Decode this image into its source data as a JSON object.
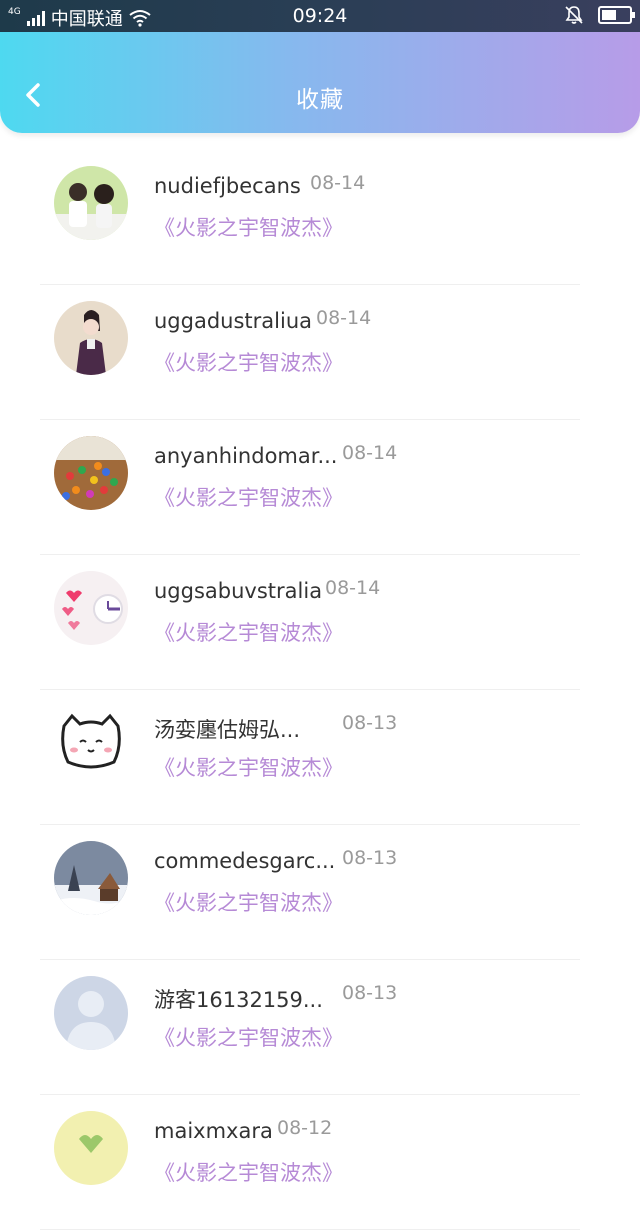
{
  "status_bar": {
    "network_tag": "4G",
    "carrier": "中国联通",
    "time": "09:24",
    "icons": [
      "signal-icon",
      "wifi-icon",
      "bell-off-icon",
      "battery-icon"
    ]
  },
  "header": {
    "title": "收藏",
    "back_icon": "chevron-left-icon"
  },
  "colors": {
    "header_gradient": [
      "#4ed9f0",
      "#86b9ee",
      "#b79ce8"
    ],
    "work_title": "#b68ad6",
    "date": "#9a9a9a"
  },
  "favorites": [
    {
      "username": "nudiefjbecans",
      "date": "08-14",
      "work": "《火影之宇智波杰》",
      "avatar": "couple-photo"
    },
    {
      "username": "uggadustraliua",
      "date": "08-14",
      "work": "《火影之宇智波杰》",
      "avatar": "girl-portrait"
    },
    {
      "username": "anyanhindomar...",
      "date": "08-14",
      "work": "《火影之宇智波杰》",
      "avatar": "sprinkles-photo"
    },
    {
      "username": "uggsabuvstralia",
      "date": "08-14",
      "work": "《火影之宇智波杰》",
      "avatar": "hearts-clock"
    },
    {
      "username": "汤娈廛估姆弘...",
      "date": "08-13",
      "work": "《火影之宇智波杰》",
      "avatar": "cartoon-cat"
    },
    {
      "username": "commedesgarc...",
      "date": "08-13",
      "work": "《火影之宇智波杰》",
      "avatar": "snow-landscape"
    },
    {
      "username": "游客16132159...",
      "date": "08-13",
      "work": "《火影之宇智波杰》",
      "avatar": "default-user"
    },
    {
      "username": "maixmxara",
      "date": "08-12",
      "work": "《火影之宇智波杰》",
      "avatar": "green-heart"
    }
  ]
}
